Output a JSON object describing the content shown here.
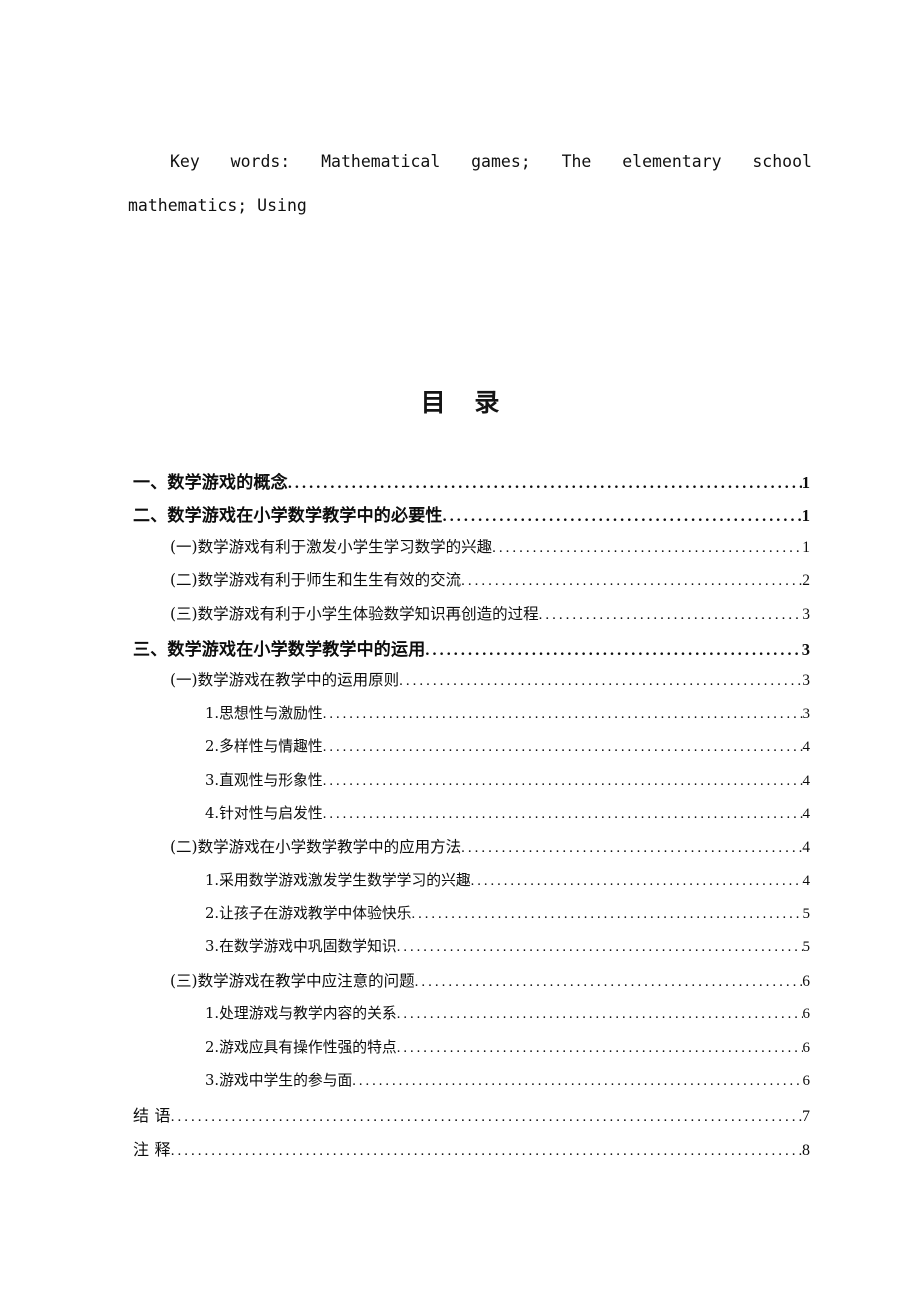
{
  "document": {
    "keywords": {
      "line1_words": [
        "Key",
        "words:",
        "Mathematical",
        "games;",
        "The",
        "elementary",
        "school"
      ],
      "line2": "mathematics; Using"
    },
    "toc_heading": "目  录",
    "toc_entries": [
      {
        "level": 1,
        "label": "一、数学游戏的概念",
        "page": "1"
      },
      {
        "level": 1,
        "label": "二、数学游戏在小学数学教学中的必要性",
        "page": "1"
      },
      {
        "level": 2,
        "label": "(一)数学游戏有利于激发小学生学习数学的兴趣",
        "page": "1"
      },
      {
        "level": 2,
        "label": "(二)数学游戏有利于师生和生生有效的交流",
        "page": "2"
      },
      {
        "level": 2,
        "label": "(三)数学游戏有利于小学生体验数学知识再创造的过程",
        "page": "3"
      },
      {
        "level": 1,
        "label": "三、数学游戏在小学数学教学中的运用",
        "page": "3"
      },
      {
        "level": 2,
        "label": "(一)数学游戏在教学中的运用原则",
        "page": "3"
      },
      {
        "level": 3,
        "label": "1.思想性与激励性",
        "page": "3"
      },
      {
        "level": 3,
        "label": "2.多样性与情趣性",
        "page": "4"
      },
      {
        "level": 3,
        "label": "3.直观性与形象性",
        "page": "4"
      },
      {
        "level": 3,
        "label": "4.针对性与启发性",
        "page": "4"
      },
      {
        "level": 2,
        "label": "(二)数学游戏在小学数学教学中的应用方法",
        "page": "4"
      },
      {
        "level": 3,
        "label": "1.采用数学游戏激发学生数学学习的兴趣",
        "page": "4"
      },
      {
        "level": 3,
        "label": "2.让孩子在游戏教学中体验快乐",
        "page": "5"
      },
      {
        "level": 3,
        "label": "3.在数学游戏中巩固数学知识",
        "page": "5"
      },
      {
        "level": 2,
        "label": "(三)数学游戏在教学中应注意的问题",
        "page": "6"
      },
      {
        "level": 3,
        "label": "1.处理游戏与教学内容的关系",
        "page": "6"
      },
      {
        "level": 3,
        "label": "2.游戏应具有操作性强的特点",
        "page": "6"
      },
      {
        "level": 3,
        "label": "3.游戏中学生的参与面",
        "page": "6"
      },
      {
        "level": 0,
        "label": "结  语",
        "page": "7"
      },
      {
        "level": 0,
        "label": "注  释",
        "page": "8"
      }
    ]
  }
}
